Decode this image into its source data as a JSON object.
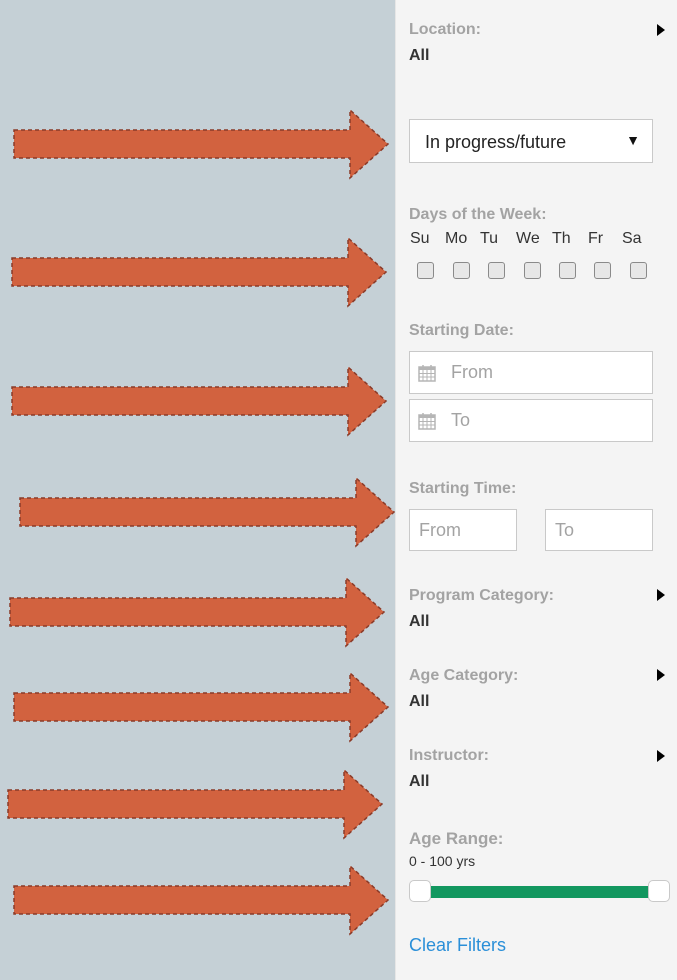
{
  "filters": {
    "location": {
      "label": "Location:",
      "value": "All"
    },
    "status_select": {
      "value": "In progress/future"
    },
    "days": {
      "label": "Days of the Week:",
      "items": [
        "Su",
        "Mo",
        "Tu",
        "We",
        "Th",
        "Fr",
        "Sa"
      ]
    },
    "starting_date": {
      "label": "Starting Date:",
      "from_placeholder": "From",
      "to_placeholder": "To"
    },
    "starting_time": {
      "label": "Starting Time:",
      "from_placeholder": "From",
      "to_placeholder": "To"
    },
    "program_category": {
      "label": "Program Category:",
      "value": "All"
    },
    "age_category": {
      "label": "Age Category:",
      "value": "All"
    },
    "instructor": {
      "label": "Instructor:",
      "value": "All"
    },
    "age_range": {
      "label": "Age Range:",
      "value": "0 - 100 yrs",
      "min": 0,
      "max": 100
    },
    "clear_label": "Clear Filters"
  },
  "colors": {
    "background": "#c5d0d6",
    "arrow_fill": "#d2623f",
    "arrow_stroke": "#8a3a28",
    "slider_track": "#12975f",
    "link": "#2a8fd8"
  }
}
